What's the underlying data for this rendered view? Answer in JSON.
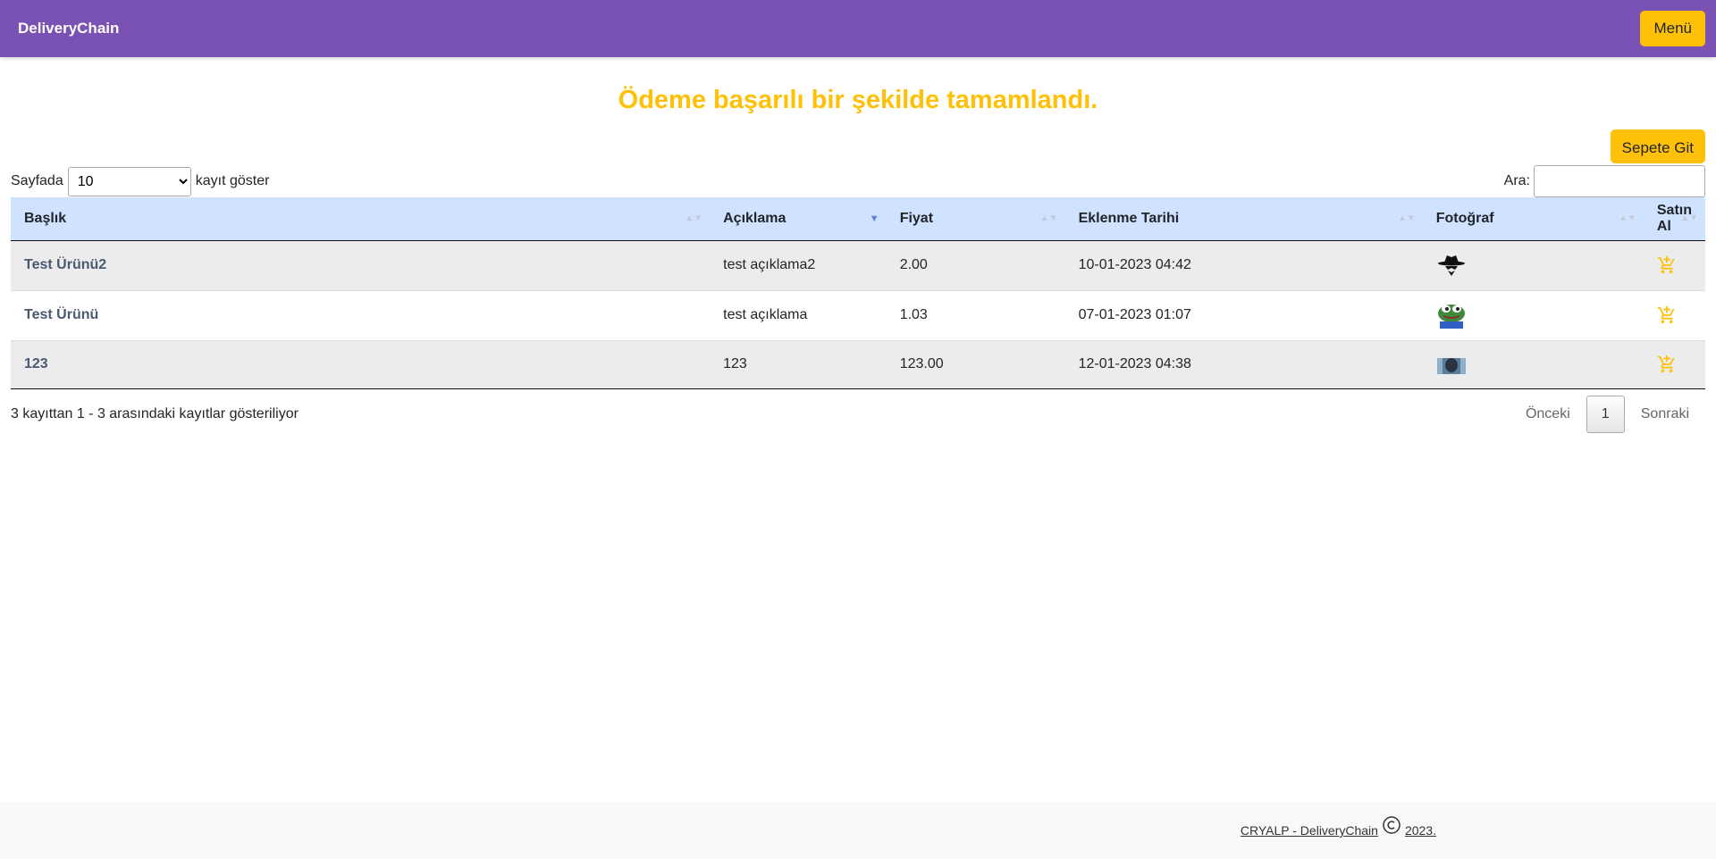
{
  "navbar": {
    "brand": "DeliveryChain",
    "menu_label": "Menü"
  },
  "headline": "Ödeme başarılı bir şekilde tamamlandı.",
  "actions": {
    "cart_label": "Sepete Git"
  },
  "length": {
    "prefix": "Sayfada",
    "selected": "10",
    "suffix": "kayıt göster"
  },
  "search": {
    "label": "Ara:",
    "value": ""
  },
  "table": {
    "columns": [
      "Başlık",
      "Açıklama",
      "Fiyat",
      "Eklenme Tarihi",
      "Fotoğraf",
      "Satın Al"
    ],
    "rows": [
      {
        "title": "Test Ürünü2",
        "description": "test açıklama2",
        "price": "2.00",
        "date": "10-01-2023 04:42",
        "photo": "spy-hat-image"
      },
      {
        "title": "Test Ürünü",
        "description": "test açıklama",
        "price": "1.03",
        "date": "07-01-2023 01:07",
        "photo": "frog-image"
      },
      {
        "title": "123",
        "description": "123",
        "price": "123.00",
        "date": "12-01-2023 04:38",
        "photo": "dark-portrait-image"
      }
    ]
  },
  "info": "3 kayıttan 1 - 3 arasındaki kayıtlar gösteriliyor",
  "paging": {
    "prev": "Önceki",
    "current": "1",
    "next": "Sonraki"
  },
  "footer": {
    "left": "CRYALP - DeliveryChain",
    "right": "2023."
  },
  "colors": {
    "navbar": "#7952b3",
    "accent": "#ffc107",
    "header_row": "#cfe2ff",
    "footer_bg": "#f8f9fa"
  }
}
